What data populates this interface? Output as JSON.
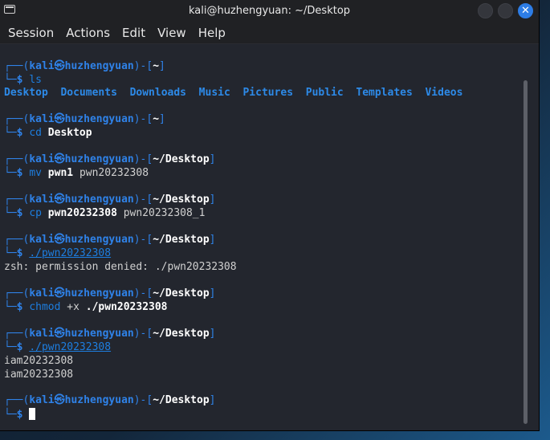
{
  "window": {
    "title": "kali@huzhengyuan: ~/Desktop"
  },
  "menu": [
    "Session",
    "Actions",
    "Edit",
    "View",
    "Help"
  ],
  "prompt": {
    "open": "┌──(",
    "user": "kali",
    "at": "㉿",
    "host": "huzhengyuan",
    "mid": ")-[",
    "close": "]",
    "bottom": "└─",
    "dollar": "$"
  },
  "blocks": [
    {
      "dir": "~",
      "cmd": "ls",
      "args": []
    },
    {
      "dir": "~",
      "cmd": "cd",
      "args": [
        {
          "t": "Desktop",
          "bold": true
        }
      ]
    },
    {
      "dir": "~/Desktop",
      "cmd": "mv",
      "args": [
        {
          "t": "pwn1",
          "bold": true
        },
        {
          "t": "pwn20232308"
        }
      ]
    },
    {
      "dir": "~/Desktop",
      "cmd": "cp",
      "args": [
        {
          "t": "pwn20232308",
          "bold": true
        },
        {
          "t": "pwn20232308_1"
        }
      ]
    },
    {
      "dir": "~/Desktop",
      "cmd": "./pwn20232308",
      "args": []
    },
    {
      "dir": "~/Desktop",
      "cmd": "chmod",
      "args": [
        {
          "t": "+x"
        },
        {
          "t": "./pwn20232308",
          "bold": true
        }
      ]
    },
    {
      "dir": "~/Desktop",
      "cmd": "./pwn20232308",
      "args": []
    },
    {
      "dir": "~/Desktop",
      "cmd": "",
      "args": []
    }
  ],
  "ls_output": [
    "Desktop",
    "Documents",
    "Downloads",
    "Music",
    "Pictures",
    "Public",
    "Templates",
    "Videos"
  ],
  "error_output": "zsh: permission denied: ./pwn20232308",
  "program_output": [
    "iam20232308",
    "iam20232308"
  ]
}
